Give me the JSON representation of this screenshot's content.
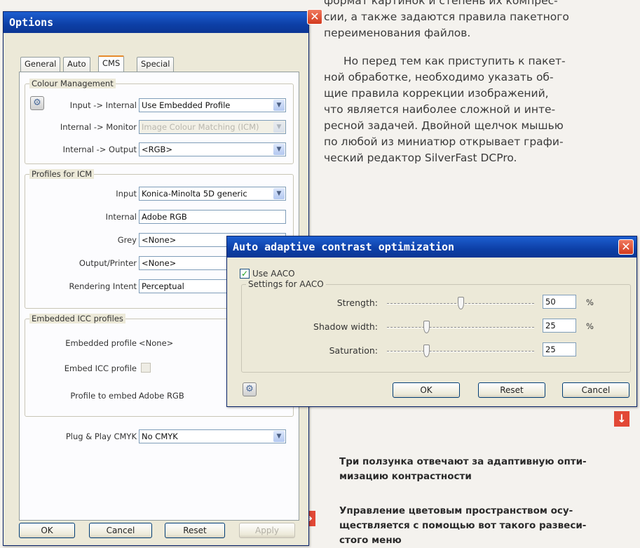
{
  "article": {
    "line1": "формат картинок и степень их компрес-",
    "line2": "сии, а также задаются правила пакетного",
    "line3": "переименования файлов.",
    "para2": [
      "Но перед тем как приступить к пакет-",
      "ной обработке, необходимо указать об-",
      "щие правила коррекции изображений,",
      "что является наиболее сложной и инте-",
      "ресной задачей. Двойной щелчок мышью",
      "по любой из миниатюр открывает графи-",
      "ческий редактор SilverFast DCPro."
    ],
    "caption1": [
      "Три ползунка отвечают за адаптивную опти-",
      "мизацию контрастности"
    ],
    "caption2": [
      "Управление цветовым пространством осу-",
      "ществляется с помощью вот такого развеси-",
      "стого меню"
    ],
    "accent_color": "#e24836"
  },
  "options": {
    "title": "Options",
    "tabs": [
      "General",
      "Auto",
      "CMS",
      "Special"
    ],
    "active_tab": "CMS",
    "colour_management": {
      "title": "Colour Management",
      "input_internal_label": "Input -> Internal",
      "input_internal_value": "Use Embedded Profile",
      "internal_monitor_label": "Internal -> Monitor",
      "internal_monitor_value": "Image Colour Matching (ICM)",
      "internal_output_label": "Internal -> Output",
      "internal_output_value": "<RGB>"
    },
    "profiles": {
      "title": "Profiles for ICM",
      "input_label": "Input",
      "input_value": "Konica-Minolta 5D generic",
      "internal_label": "Internal",
      "internal_value": "Adobe RGB",
      "grey_label": "Grey",
      "grey_value": "<None>",
      "output_label": "Output/Printer",
      "output_value": "<None>",
      "intent_label": "Rendering Intent",
      "intent_value": "Perceptual"
    },
    "embedded": {
      "title": "Embedded ICC profiles",
      "embedded_profile_label": "Embedded profile",
      "embedded_profile_value": "<None>",
      "embed_icc_label": "Embed ICC profile",
      "profile_to_embed_label": "Profile to embed",
      "profile_to_embed_value": "Adobe RGB"
    },
    "plug_play_label": "Plug & Play CMYK",
    "plug_play_value": "No CMYK",
    "buttons": {
      "ok": "OK",
      "cancel": "Cancel",
      "reset": "Reset",
      "apply": "Apply"
    }
  },
  "aaco": {
    "title": "Auto adaptive contrast optimization",
    "use_label": "Use AACO",
    "group_title": "Settings for AACO",
    "strength_label": "Strength:",
    "strength_value": "50",
    "strength_unit": "%",
    "shadow_label": "Shadow width:",
    "shadow_value": "25",
    "shadow_unit": "%",
    "saturation_label": "Saturation:",
    "saturation_value": "25",
    "buttons": {
      "ok": "OK",
      "reset": "Reset",
      "cancel": "Cancel"
    }
  }
}
